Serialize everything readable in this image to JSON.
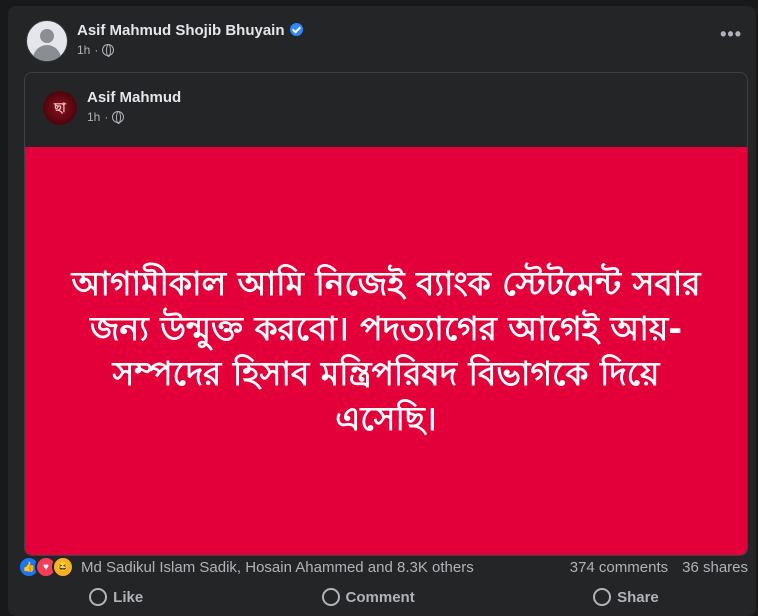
{
  "post": {
    "author": "Asif Mahmud Shojib Bhuyain",
    "time": "1h",
    "separator": "·",
    "more_label": "•••",
    "icons": {
      "verified": "verified-badge-icon",
      "audience": "globe-icon",
      "more": "more-options-icon"
    }
  },
  "shared": {
    "author": "Asif Mahmud",
    "avatar_text": "ছা",
    "time": "1h",
    "separator": "·",
    "banner_text": "আগামীকাল আমি নিজেই ব্যাংক স্টেটমেন্ট সবার জন্য উন্মুক্ত করবো। পদত্যাগের আগেই আয়-সম্পদের হিসাব মন্ত্রিপরিষদ বিভাগকে দিয়ে এসেছি।",
    "banner_color": "#e3003a"
  },
  "engagement": {
    "reactions_text": "Md Sadikul Islam Sadik, Hosain Ahammed and 8.3K others",
    "comments": "374 comments",
    "shares": "36 shares",
    "reaction_icons": [
      "like-icon",
      "love-icon",
      "haha-icon"
    ]
  },
  "actions": {
    "like": "Like",
    "comment": "Comment",
    "share": "Share"
  }
}
